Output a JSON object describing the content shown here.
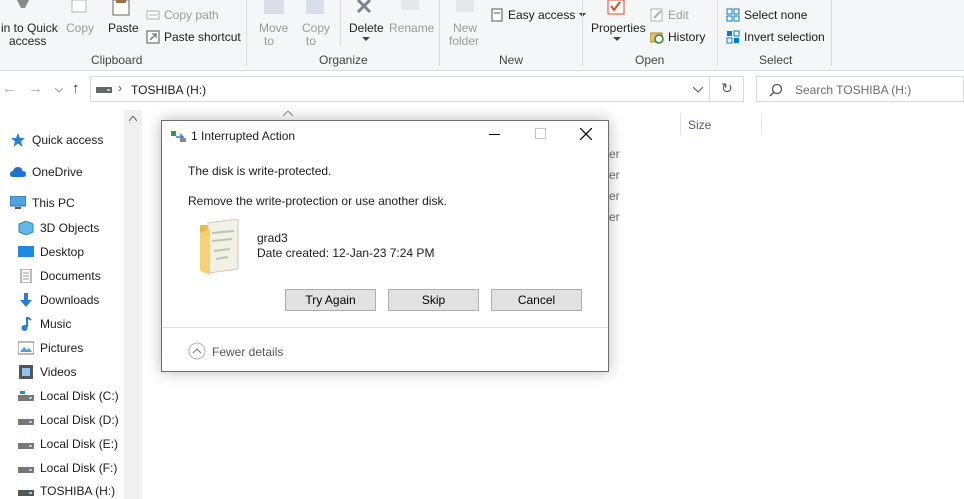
{
  "ribbon": {
    "clipboard": {
      "pin_label_1": "in to Quick",
      "pin_label_2": "access",
      "copy_label": "Copy",
      "paste_label": "Paste",
      "copy_path_label": "Copy path",
      "paste_shortcut_label": "Paste shortcut",
      "group_label": "Clipboard"
    },
    "organize": {
      "move_to_1": "Move",
      "move_to_2": "to",
      "copy_to_1": "Copy",
      "copy_to_2": "to",
      "delete_label": "Delete",
      "rename_label": "Rename",
      "group_label": "Organize"
    },
    "new": {
      "new_folder_1": "New",
      "new_folder_2": "folder",
      "easy_access_label": "Easy access",
      "group_label": "New"
    },
    "open": {
      "properties_label": "Properties",
      "edit_label": "Edit",
      "history_label": "History",
      "group_label": "Open"
    },
    "select": {
      "select_none_label": "Select none",
      "invert_selection_label": "Invert selection",
      "group_label": "Select"
    }
  },
  "address": {
    "path": "TOSHIBA (H:)",
    "search_placeholder": "Search TOSHIBA (H:)"
  },
  "columns": {
    "size_header": "Size"
  },
  "file_list_fragments": [
    "er",
    "er",
    "er",
    "er"
  ],
  "nav": {
    "items": [
      {
        "label": "Quick access",
        "icon": "star-icon"
      },
      {
        "label": "OneDrive",
        "icon": "cloud-icon"
      },
      {
        "label": "This PC",
        "icon": "computer-icon"
      },
      {
        "label": "3D Objects",
        "icon": "cube-icon"
      },
      {
        "label": "Desktop",
        "icon": "desktop-icon"
      },
      {
        "label": "Documents",
        "icon": "document-icon"
      },
      {
        "label": "Downloads",
        "icon": "download-icon"
      },
      {
        "label": "Music",
        "icon": "music-icon"
      },
      {
        "label": "Pictures",
        "icon": "picture-icon"
      },
      {
        "label": "Videos",
        "icon": "video-icon"
      },
      {
        "label": "Local Disk (C:)",
        "icon": "drive-icon"
      },
      {
        "label": "Local Disk (D:)",
        "icon": "drive-icon"
      },
      {
        "label": "Local Disk (E:)",
        "icon": "drive-icon"
      },
      {
        "label": "Local Disk (F:)",
        "icon": "drive-icon"
      },
      {
        "label": "TOSHIBA (H:)",
        "icon": "drive-icon"
      }
    ]
  },
  "dialog": {
    "title": "1 Interrupted Action",
    "message": "The disk is write-protected.",
    "instruction": "Remove the write-protection or use another disk.",
    "file_name": "grad3",
    "file_date": "Date created: 12-Jan-23 7:24 PM",
    "try_again_label": "Try Again",
    "skip_label": "Skip",
    "cancel_label": "Cancel",
    "details_label": "Fewer details"
  },
  "colors": {
    "accent": "#0078d7",
    "ribbon_bg": "#f5f6f7",
    "button_bg": "#e1e1e1",
    "folder_yellow": "#f3d27a"
  }
}
